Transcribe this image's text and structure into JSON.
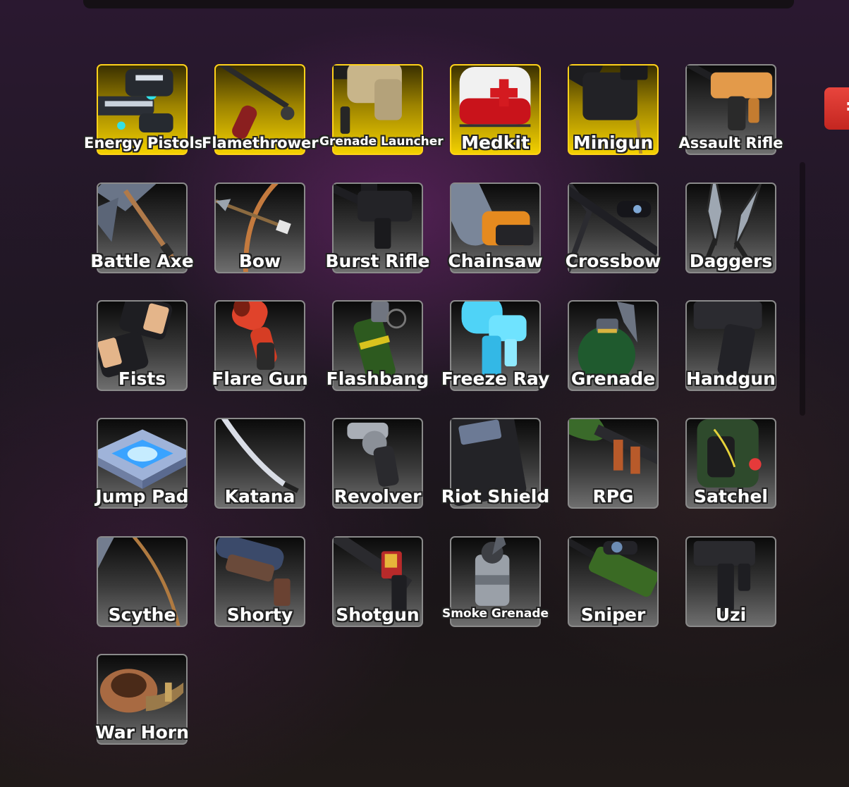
{
  "inventory": {
    "items": [
      {
        "label": "Energy Pistols",
        "icon": "energy-pistols-icon",
        "owned": true
      },
      {
        "label": "Flamethrower",
        "icon": "flamethrower-icon",
        "owned": true
      },
      {
        "label": "Grenade Launcher",
        "icon": "grenade-launcher-icon",
        "owned": true
      },
      {
        "label": "Medkit",
        "icon": "medkit-icon",
        "owned": true
      },
      {
        "label": "Minigun",
        "icon": "minigun-icon",
        "owned": true
      },
      {
        "label": "Assault Rifle",
        "icon": "assault-rifle-icon",
        "owned": false
      },
      {
        "label": "Battle Axe",
        "icon": "battle-axe-icon",
        "owned": false
      },
      {
        "label": "Bow",
        "icon": "bow-icon",
        "owned": false
      },
      {
        "label": "Burst Rifle",
        "icon": "burst-rifle-icon",
        "owned": false
      },
      {
        "label": "Chainsaw",
        "icon": "chainsaw-icon",
        "owned": false
      },
      {
        "label": "Crossbow",
        "icon": "crossbow-icon",
        "owned": false
      },
      {
        "label": "Daggers",
        "icon": "daggers-icon",
        "owned": false
      },
      {
        "label": "Fists",
        "icon": "fists-icon",
        "owned": false
      },
      {
        "label": "Flare Gun",
        "icon": "flare-gun-icon",
        "owned": false
      },
      {
        "label": "Flashbang",
        "icon": "flashbang-icon",
        "owned": false
      },
      {
        "label": "Freeze Ray",
        "icon": "freeze-ray-icon",
        "owned": false
      },
      {
        "label": "Grenade",
        "icon": "grenade-icon",
        "owned": false
      },
      {
        "label": "Handgun",
        "icon": "handgun-icon",
        "owned": false
      },
      {
        "label": "Jump Pad",
        "icon": "jump-pad-icon",
        "owned": false
      },
      {
        "label": "Katana",
        "icon": "katana-icon",
        "owned": false
      },
      {
        "label": "Revolver",
        "icon": "revolver-icon",
        "owned": false
      },
      {
        "label": "Riot Shield",
        "icon": "riot-shield-icon",
        "owned": false
      },
      {
        "label": "RPG",
        "icon": "rpg-icon",
        "owned": false
      },
      {
        "label": "Satchel",
        "icon": "satchel-icon",
        "owned": false
      },
      {
        "label": "Scythe",
        "icon": "scythe-icon",
        "owned": false
      },
      {
        "label": "Shorty",
        "icon": "shorty-icon",
        "owned": false
      },
      {
        "label": "Shotgun",
        "icon": "shotgun-icon",
        "owned": false
      },
      {
        "label": "Smoke Grenade",
        "icon": "smoke-grenade-icon",
        "owned": false
      },
      {
        "label": "Sniper",
        "icon": "sniper-icon",
        "owned": false
      },
      {
        "label": "Uzi",
        "icon": "uzi-icon",
        "owned": false
      },
      {
        "label": "War Horn",
        "icon": "war-horn-icon",
        "owned": false
      }
    ]
  },
  "colors": {
    "owned_border": "#ffd21a",
    "owned_fill": "#f3d100",
    "default_border": "#8a8a8a",
    "close_tab": "#e8453d"
  }
}
